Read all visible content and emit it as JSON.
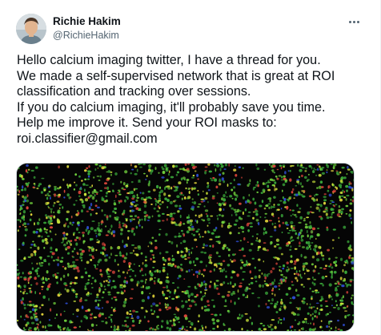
{
  "tweet": {
    "author": {
      "display_name": "Richie Hakim",
      "handle": "@RichieHakim"
    },
    "more_icon": "more-horizontal-icon",
    "text_lines": [
      "Hello calcium imaging twitter, I have a thread for you.",
      "We made a self-supervised network that is great at ROI",
      "classification and tracking over sessions.",
      "If you do calcium imaging, it'll probably save you time.",
      "Help me improve it. Send your ROI masks to:",
      "roi.classifier@gmail.com"
    ],
    "media": {
      "roi_colors": [
        "#3aa83a",
        "#6fcf3c",
        "#c9e23a",
        "#e0d23a",
        "#d8453a",
        "#2f4fd6"
      ],
      "background": "#050505"
    }
  },
  "colors": {
    "text": "#0f1419",
    "secondary": "#536471",
    "border": "#cfd9de"
  }
}
